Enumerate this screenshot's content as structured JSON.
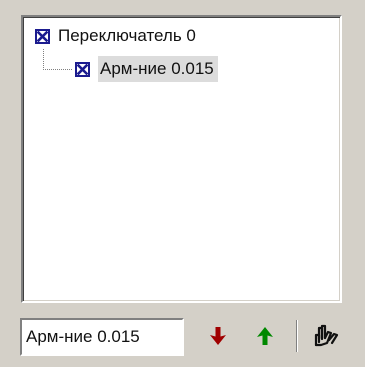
{
  "tree": {
    "items": [
      {
        "label": "Переключатель 0",
        "checked": true,
        "level": 0
      },
      {
        "label": "Арм-ние 0.015",
        "checked": true,
        "level": 1,
        "selected": true
      }
    ]
  },
  "name_field": {
    "value": "Арм-ние 0.015"
  },
  "toolbar": {
    "move_down_icon": "red-down-arrow-icon",
    "move_up_icon": "green-up-arrow-icon",
    "hand_icon": "hand-icon"
  },
  "colors": {
    "window_bg": "#d4d0c8",
    "checkbox_mark": "#1b1b8f",
    "arrow_down": "#a00000",
    "arrow_up": "#008800",
    "selection_bg": "#dcdcdc"
  }
}
